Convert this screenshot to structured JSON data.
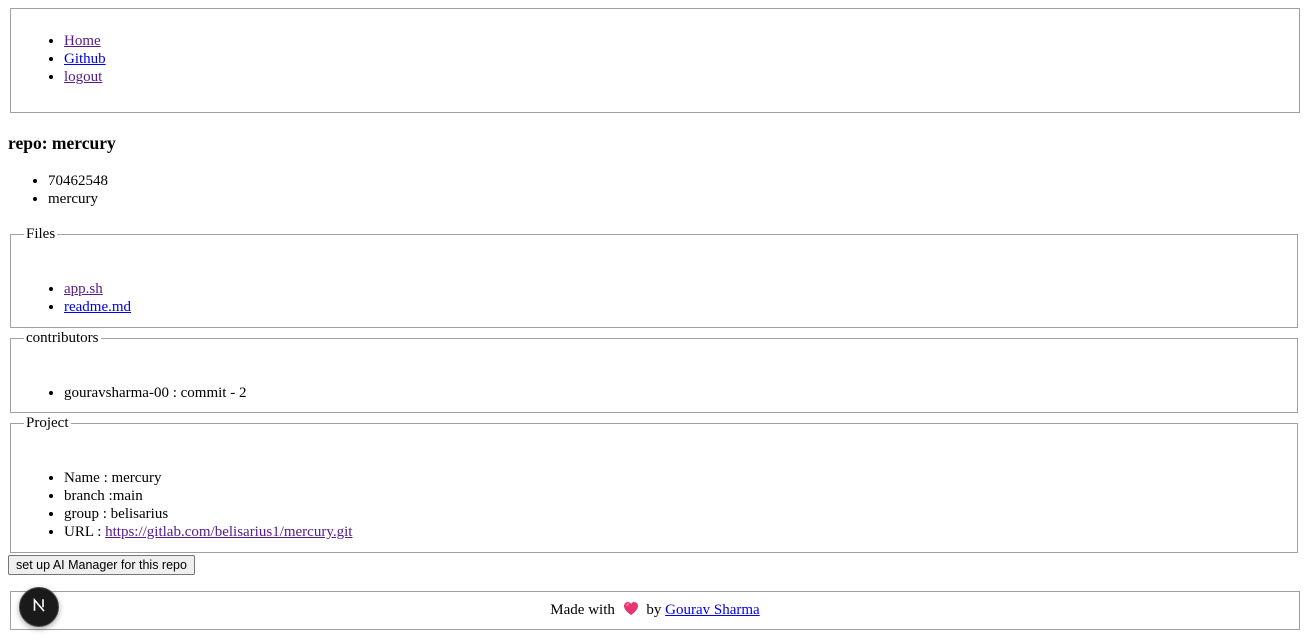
{
  "nav": {
    "links": [
      "Home",
      "Github",
      "logout"
    ]
  },
  "repo": {
    "title": "repo: mercury",
    "info": [
      "70462548",
      "mercury"
    ]
  },
  "files": {
    "legend": "Files",
    "items": [
      "app.sh",
      "readme.md"
    ]
  },
  "contributors": {
    "legend": "contributors",
    "items": [
      "gouravsharma-00 : commit - 2"
    ]
  },
  "project": {
    "legend": "Project",
    "name": "Name : mercury",
    "branch": "branch :main",
    "group": "group : belisarius",
    "url_label": "URL : ",
    "url": "https://gitlab.com/belisarius1/mercury.git"
  },
  "actions": {
    "ai_button": "set up AI Manager for this repo"
  },
  "footer": {
    "made_with": "Made with",
    "by": "by",
    "author": "Gourav Sharma"
  },
  "colors": {
    "link": "#0000ee",
    "visited_link": "#551a8b",
    "heart": "#e8356d",
    "badge_bg": "#1a1a1a"
  },
  "icons": {
    "heart": "heart-icon",
    "badge": "nextjs-logo-icon"
  }
}
